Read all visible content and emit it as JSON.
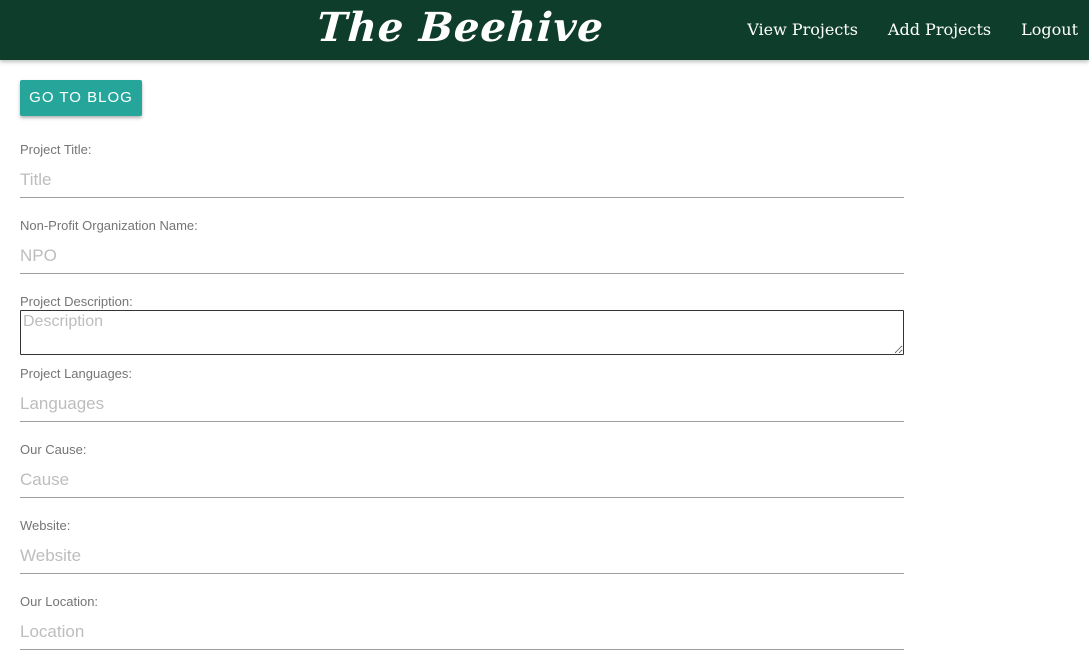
{
  "navbar": {
    "brand": "The Beehive",
    "links": [
      "View Projects",
      "Add Projects",
      "Logout"
    ],
    "background": "#0f3d2c"
  },
  "blog_button": {
    "label": "Go to Blog",
    "color": "#26a69a"
  },
  "form": {
    "title": {
      "label": "Project Title:",
      "placeholder": "Title"
    },
    "npo": {
      "label": "Non-Profit Organization Name:",
      "placeholder": "NPO"
    },
    "description": {
      "label": "Project Description:",
      "placeholder": "Description"
    },
    "languages": {
      "label": "Project Languages:",
      "placeholder": "Languages"
    },
    "cause": {
      "label": "Our Cause:",
      "placeholder": "Cause"
    },
    "website": {
      "label": "Website:",
      "placeholder": "Website"
    },
    "location": {
      "label": "Our Location:",
      "placeholder": "Location"
    }
  }
}
